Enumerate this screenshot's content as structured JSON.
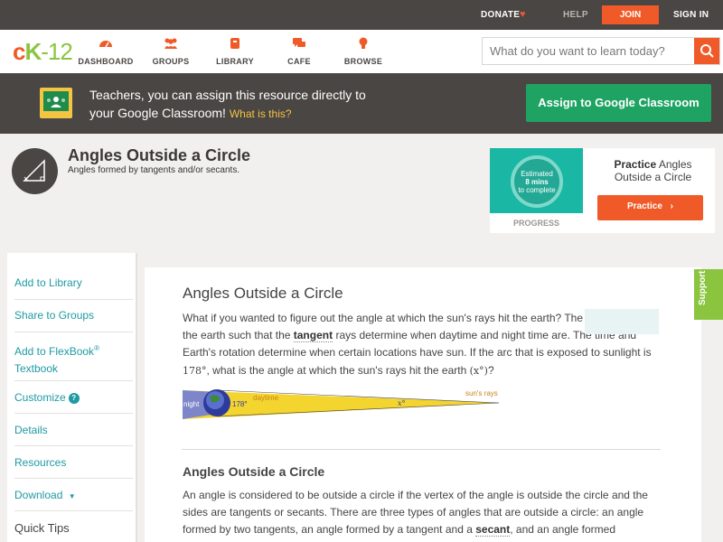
{
  "topbar": {
    "donate": "DONATE",
    "help": "HELP",
    "join": "JOIN",
    "signin": "SIGN IN"
  },
  "logo": {
    "c": "c",
    "k": "K",
    "num": "-12"
  },
  "nav": {
    "dashboard": "DASHBOARD",
    "groups": "GROUPS",
    "library": "LIBRARY",
    "cafe": "CAFE",
    "browse": "BROWSE"
  },
  "search": {
    "placeholder": "What do you want to learn today?"
  },
  "banner": {
    "line1": "Teachers, you can assign this resource directly to",
    "line2": "your Google Classroom!",
    "what": "What is this?",
    "assign": "Assign to Google Classroom"
  },
  "header": {
    "title": "Angles Outside a Circle",
    "subtitle": "Angles formed by tangents and/or secants."
  },
  "practice_card": {
    "estimated_1": "Estimated",
    "estimated_2": "8 mins",
    "estimated_3": "to complete",
    "progress": "PROGRESS",
    "practice_word": "Practice",
    "practice_topic": "Angles Outside a Circle",
    "button": "Practice"
  },
  "sidebar": {
    "add_library": "Add to Library",
    "share_groups": "Share to Groups",
    "add_flexbook_1": "Add to FlexBook",
    "add_flexbook_2": "Textbook",
    "customize": "Customize",
    "details": "Details",
    "resources": "Resources",
    "download": "Download",
    "quick_tips": "Quick Tips"
  },
  "content": {
    "title": "Angles Outside a Circle",
    "p1_a": "What if you wanted to figure out the angle at which the sun's rays hit the earth? The sun's rays hit the earth such that the",
    "p1_term": "tangent",
    "p1_b": "rays determine when daytime and night time are. The time and Earth's rotation determine when certain locations have sun. If the arc that is exposed to sunlight is",
    "p1_deg": "178°",
    "p1_c": ", what is the angle at which the sun's rays hit the earth",
    "p1_x": "(x°)",
    "p1_d": "?",
    "figure": {
      "night": "night",
      "arc": "178°",
      "daytime": "daytime",
      "x": "x°",
      "sun": "sun's rays"
    },
    "h2": "Angles Outside a Circle",
    "p2_a": "An angle is considered to be outside a circle if the vertex of the angle is outside the circle and the sides are tangents or secants. There are three types of angles that are outside a circle: an angle formed by two tangents, an angle formed by a tangent and a",
    "p2_term": "secant",
    "p2_b": ", and an angle formed"
  },
  "support": "Support",
  "colors": {
    "accent": "#f05a28",
    "brand_green": "#8bc540",
    "link": "#1e9aa3",
    "dark": "#4a4643",
    "google_green": "#1ea362"
  }
}
